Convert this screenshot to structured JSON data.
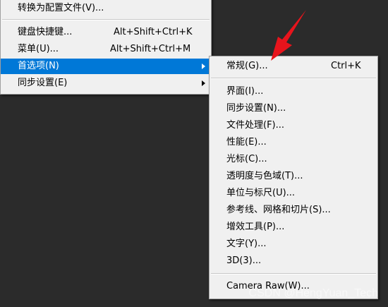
{
  "main_menu": {
    "convert_to_preset": "转换为配置文件(V)...",
    "keyboard_shortcuts": {
      "label": "键盘快捷键...",
      "shortcut": "Alt+Shift+Ctrl+K"
    },
    "menus": {
      "label": "菜单(U)...",
      "shortcut": "Alt+Shift+Ctrl+M"
    },
    "preferences": "首选项(N)",
    "sync_settings": "同步设置(E)"
  },
  "preferences_submenu": {
    "general": {
      "label": "常规(G)...",
      "shortcut": "Ctrl+K"
    },
    "items": [
      "界面(I)...",
      "同步设置(N)...",
      "文件处理(F)...",
      "性能(E)...",
      "光标(C)...",
      "透明度与色域(T)...",
      "单位与标尺(U)...",
      "参考线、网格和切片(S)...",
      "增效工具(P)...",
      "文字(Y)...",
      "3D(3)..."
    ],
    "camera_raw": "Camera Raw(W)..."
  },
  "annotation": {
    "arrow_color": "#e8141c"
  },
  "watermark": "CSDN @HengYuan_Tech",
  "colors": {
    "highlight": "#0078d7",
    "menu_bg": "#f0f0f0",
    "desktop_bg": "#2b2b2b"
  }
}
